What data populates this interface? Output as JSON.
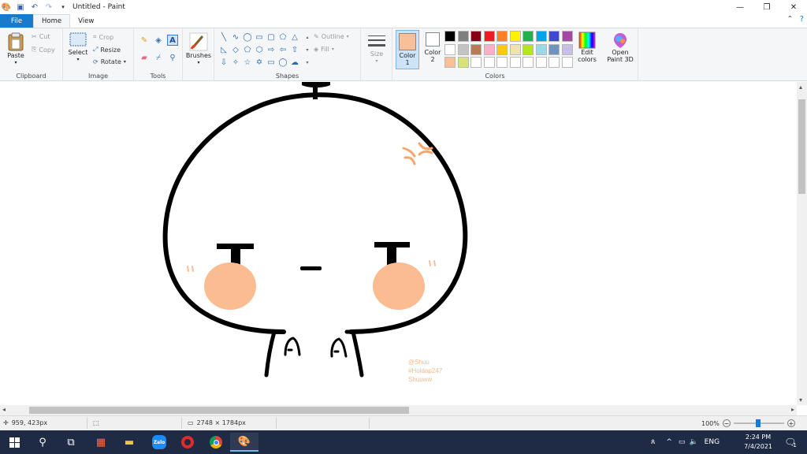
{
  "window": {
    "title": "Untitled - Paint"
  },
  "tabs": [
    "File",
    "Home",
    "View"
  ],
  "ribbon": {
    "clipboard": {
      "label": "Clipboard",
      "paste": "Paste",
      "cut": "Cut",
      "copy": "Copy"
    },
    "image": {
      "label": "Image",
      "select": "Select",
      "crop": "Crop",
      "resize": "Resize",
      "rotate": "Rotate"
    },
    "tools": {
      "label": "Tools"
    },
    "brushes": {
      "label": "Brushes"
    },
    "shapes": {
      "label": "Shapes",
      "outline": "Outline",
      "fill": "Fill"
    },
    "size": {
      "label": "Size"
    },
    "colors": {
      "label": "Colors",
      "color1": "Color 1",
      "color2": "Color 2",
      "color1_value": "#f9bf96",
      "color2_value": "#ffffff",
      "edit_colors": "Edit colors",
      "open_paint3d": "Open Paint 3D",
      "palette_row1": [
        "#000000",
        "#7f7f7f",
        "#880015",
        "#ed1c24",
        "#ff7f27",
        "#fff200",
        "#22b14c",
        "#00a2e8",
        "#3f48cc",
        "#a349a4"
      ],
      "palette_row2": [
        "#ffffff",
        "#c3c3c3",
        "#b97a57",
        "#ffaec9",
        "#ffc90e",
        "#efe4b0",
        "#b5e61d",
        "#99d9ea",
        "#7092be",
        "#c8bfe7"
      ],
      "palette_row3": [
        "#f9bf96",
        "#d7e27a",
        "#ffffff",
        "#ffffff",
        "#ffffff",
        "#ffffff",
        "#ffffff",
        "#ffffff",
        "#ffffff",
        "#ffffff"
      ]
    }
  },
  "canvas": {
    "watermark_lines": [
      "@Shuu",
      "#Holdap247",
      "Shuuww"
    ],
    "watermark_color": "#f2b98f",
    "cheek_color": "#fbbc92"
  },
  "status": {
    "cursor_pos": "959, 423px",
    "image_size": "2748 × 1784px",
    "zoom": "100%"
  },
  "taskbar": {
    "lang": "ENG",
    "time": "2:24 PM",
    "date": "7/4/2021",
    "notification_count": "1",
    "zalo_label": "Zalo"
  }
}
